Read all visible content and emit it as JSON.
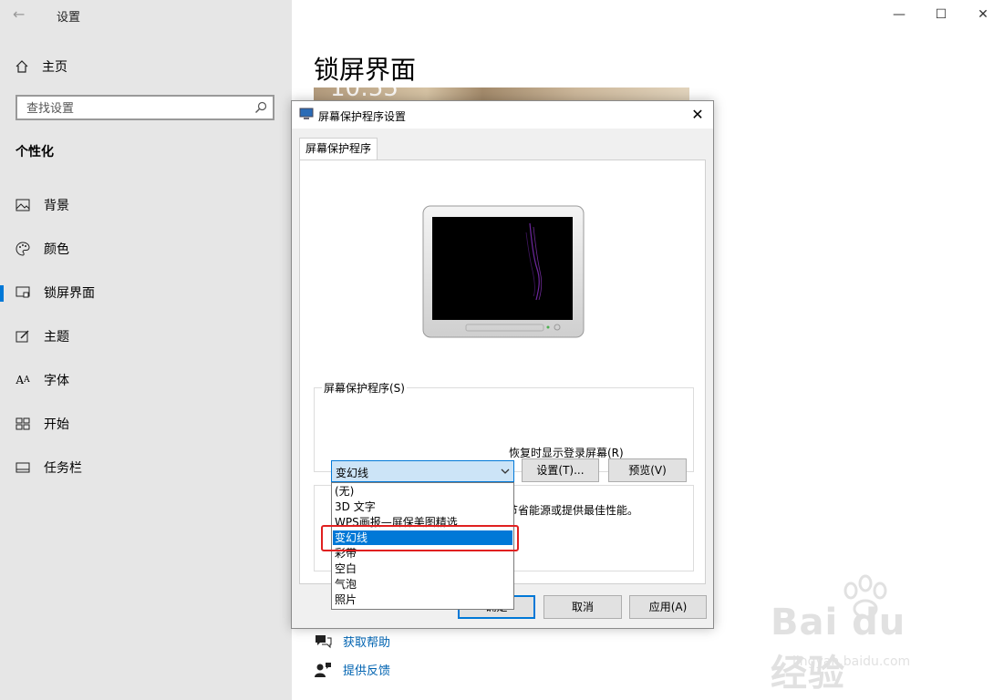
{
  "settings": {
    "app_title": "设置",
    "home_label": "主页",
    "search_placeholder": "查找设置",
    "section_title": "个性化",
    "nav": [
      {
        "label": "背景",
        "icon": "picture-icon"
      },
      {
        "label": "颜色",
        "icon": "palette-icon"
      },
      {
        "label": "锁屏界面",
        "icon": "lock-screen-icon",
        "active": true
      },
      {
        "label": "主题",
        "icon": "theme-icon"
      },
      {
        "label": "字体",
        "icon": "font-icon"
      },
      {
        "label": "开始",
        "icon": "start-icon"
      },
      {
        "label": "任务栏",
        "icon": "taskbar-icon"
      }
    ],
    "page_title": "锁屏界面",
    "preview_clock": "10:55",
    "help_link": "获取帮助",
    "feedback_link": "提供反馈",
    "accent_color": "#0078d7",
    "link_color": "#0063b1"
  },
  "dialog": {
    "title": "屏幕保护程序设置",
    "tab": "屏幕保护程序",
    "group_label": "屏幕保护程序(S)",
    "selected": "变幻线",
    "settings_button": "设置(T)...",
    "preview_button": "预览(V)",
    "options": [
      "(无)",
      "3D 文字",
      "WPS画报—屏保美图精选",
      "变幻线",
      "彩带",
      "空白",
      "气泡",
      "照片"
    ],
    "highlighted_index": 3,
    "partial_resume_text": "恢复时显示登录屏幕(R)",
    "partial_power_text": "节省能源或提供最佳性能。",
    "ok_button": "确定",
    "cancel_button": "取消",
    "apply_button": "应用(A)",
    "highlight_box_color": "#e02020"
  },
  "watermark": {
    "brand": "Bai du 经验",
    "url": "jingyan.baidu.com"
  }
}
